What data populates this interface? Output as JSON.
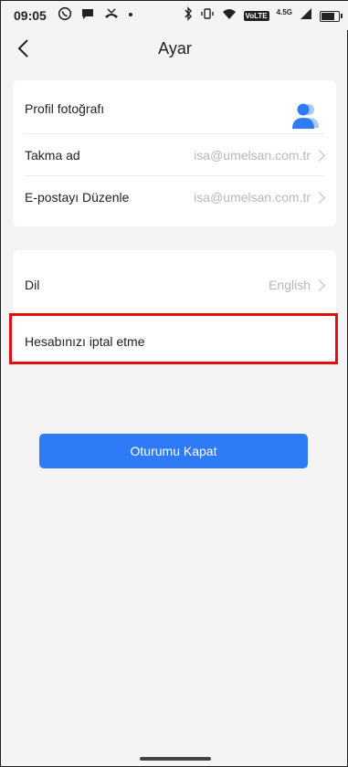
{
  "status_bar": {
    "time": "09:05",
    "network_label": "4.5G",
    "volte_label": "VoLTE",
    "signal_text": "1",
    "battery_level": 0.85
  },
  "header": {
    "title": "Ayar"
  },
  "account_card": {
    "profile_photo_label": "Profil fotoğrafı",
    "nickname_label": "Takma ad",
    "nickname_value": "isa@umelsan.com.tr",
    "email_label": "E-postayı Düzenle",
    "email_value": "isa@umelsan.com.tr",
    "avatar_color": "#2f7af6"
  },
  "settings_card": {
    "language_label": "Dil",
    "language_value": "English",
    "cancel_account_label": "Hesabınızı iptal etme"
  },
  "logout_button": {
    "label": "Oturumu Kapat",
    "color": "#2f7af6"
  },
  "highlight_color": "#e01010"
}
